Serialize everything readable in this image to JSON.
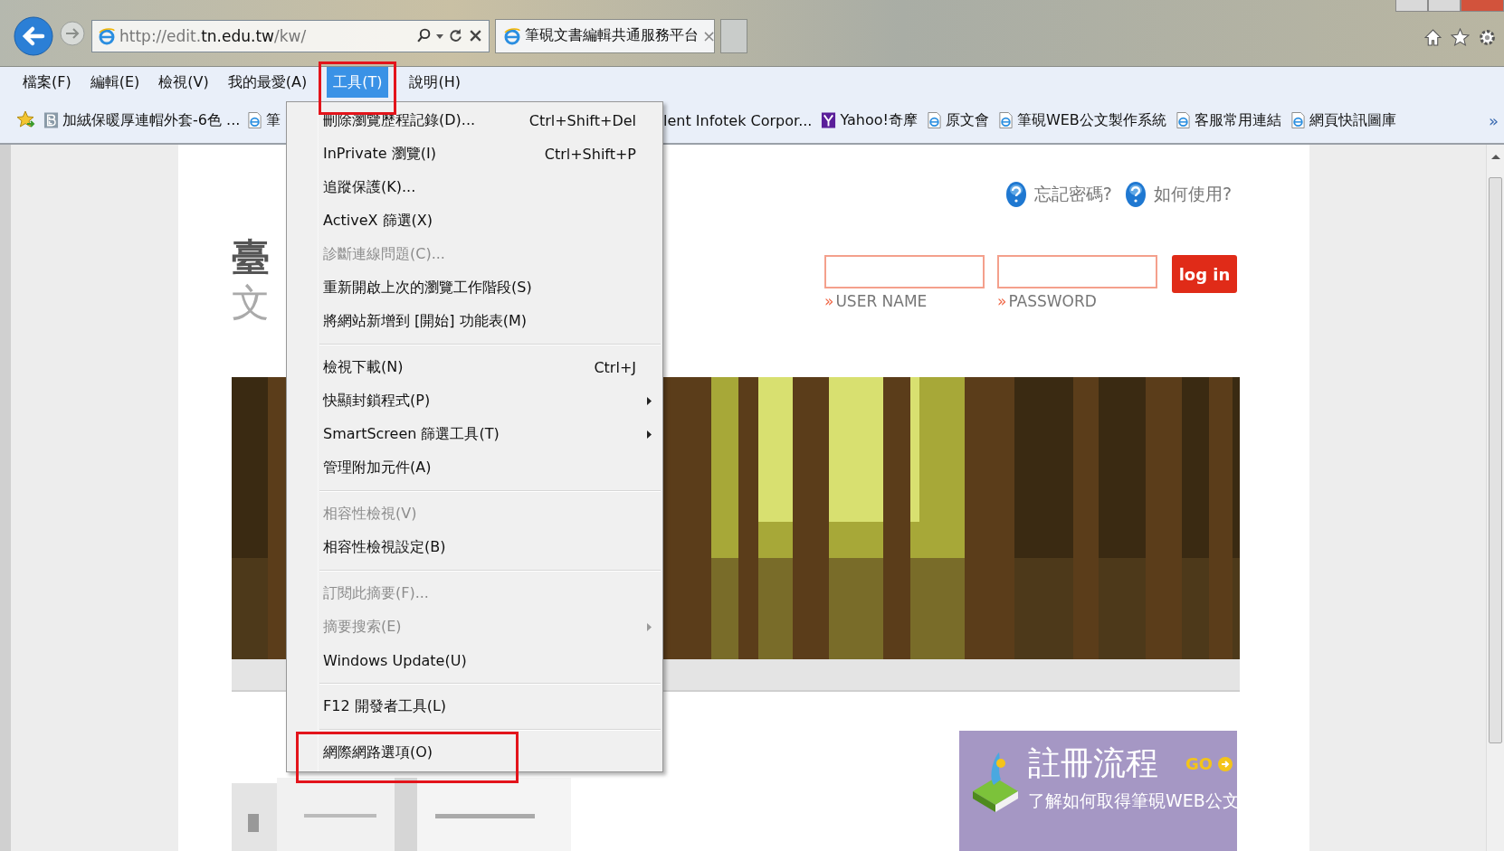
{
  "browser": {
    "address": "http://edit.**tn.edu.tw**/kw/",
    "tabs": [
      {
        "title": "筆硯文書編輯共通服務平台",
        "close": "×",
        "selected": true
      }
    ]
  },
  "menu_bar": [
    {
      "label": "檔案(F)",
      "selected": false,
      "annotated": false
    },
    {
      "label": "編輯(E)",
      "selected": false,
      "annotated": false
    },
    {
      "label": "檢視(V)",
      "selected": false,
      "annotated": false
    },
    {
      "label": "我的最愛(A)",
      "selected": false,
      "annotated": false
    },
    {
      "label": "工具(T)",
      "selected": true,
      "annotated": true
    },
    {
      "label": "說明(H)",
      "selected": false,
      "annotated": false
    }
  ],
  "favorites": {
    "left": [
      {
        "kind": "letter",
        "label": "加絨保暖厚連帽外套-6色 ..."
      },
      {
        "kind": "page",
        "label": "筆"
      }
    ],
    "right": [
      {
        "kind": "plain",
        "label": "lent Infotek Corpor..."
      },
      {
        "kind": "portal",
        "label": "Yahoo!奇摩"
      },
      {
        "kind": "page",
        "label": "原文會"
      },
      {
        "kind": "page",
        "label": "筆硯WEB公文製作系統"
      },
      {
        "kind": "page",
        "label": "客服常用連結"
      },
      {
        "kind": "page",
        "label": "網頁快訊圖庫"
      }
    ],
    "more": "»"
  },
  "tools_menu": {
    "groups": [
      [
        {
          "label": "刪除瀏覽歷程記錄(D)...",
          "shortcut": "Ctrl+Shift+Del",
          "disabled": false,
          "submenu": false,
          "annotated": false
        },
        {
          "label": "InPrivate 瀏覽(I)",
          "shortcut": "Ctrl+Shift+P",
          "disabled": false,
          "submenu": false,
          "annotated": false
        },
        {
          "label": "追蹤保護(K)...",
          "disabled": false,
          "submenu": false,
          "annotated": false
        },
        {
          "label": "ActiveX 篩選(X)",
          "disabled": false,
          "submenu": false,
          "annotated": false
        },
        {
          "label": "診斷連線問題(C)...",
          "disabled": true,
          "submenu": false,
          "annotated": false
        },
        {
          "label": "重新開啟上次的瀏覽工作階段(S)",
          "disabled": false,
          "submenu": false,
          "annotated": false
        },
        {
          "label": "將網站新增到 [開始] 功能表(M)",
          "disabled": false,
          "submenu": false,
          "annotated": false
        }
      ],
      [
        {
          "label": "檢視下載(N)",
          "shortcut": "Ctrl+J",
          "disabled": false,
          "submenu": false,
          "annotated": false
        },
        {
          "label": "快顯封鎖程式(P)",
          "disabled": false,
          "submenu": true,
          "annotated": false
        },
        {
          "label": "SmartScreen 篩選工具(T)",
          "disabled": false,
          "submenu": true,
          "annotated": false
        },
        {
          "label": "管理附加元件(A)",
          "disabled": false,
          "submenu": false,
          "annotated": false
        }
      ],
      [
        {
          "label": "相容性檢視(V)",
          "disabled": true,
          "submenu": false,
          "annotated": false
        },
        {
          "label": "相容性檢視設定(B)",
          "disabled": false,
          "submenu": false,
          "annotated": false
        }
      ],
      [
        {
          "label": "訂閱此摘要(F)...",
          "disabled": true,
          "submenu": false,
          "annotated": false
        },
        {
          "label": "摘要搜索(E)",
          "disabled": true,
          "submenu": true,
          "annotated": false
        },
        {
          "label": "Windows Update(U)",
          "disabled": false,
          "submenu": false,
          "annotated": false
        }
      ],
      [
        {
          "label": "F12 開發者工具(L)",
          "disabled": false,
          "submenu": false,
          "annotated": false
        }
      ],
      [
        {
          "label": "網際網路選項(O)",
          "disabled": false,
          "submenu": false,
          "annotated": true
        }
      ]
    ]
  },
  "page": {
    "title_lines": [
      "臺",
      "文"
    ],
    "help_links": [
      "忘記密碼?",
      "如何使用?"
    ],
    "login": {
      "fields": [
        {
          "label": "USER NAME",
          "marker": "»"
        },
        {
          "label": "PASSWORD",
          "marker": "»"
        }
      ],
      "button": "log in"
    },
    "register": {
      "title": "註冊流程",
      "go": "GO",
      "text": "了解如何取得筆硯WEB公文"
    }
  }
}
